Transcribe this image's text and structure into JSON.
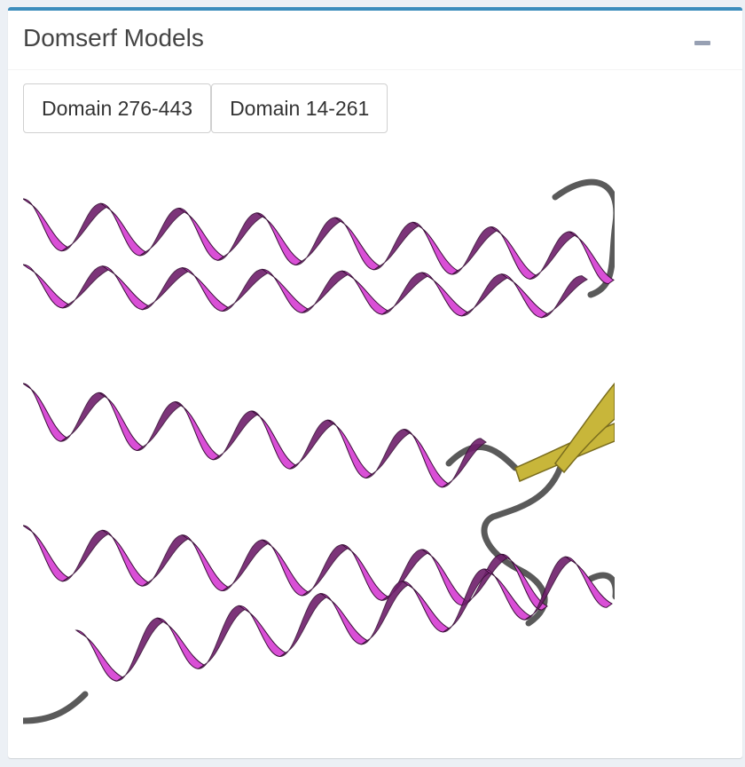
{
  "panel": {
    "title": "Domserf Models",
    "collapse_icon": "minus-icon"
  },
  "domain_buttons": [
    {
      "label": "Domain 276-443"
    },
    {
      "label": "Domain 14-261"
    }
  ],
  "viewer": {
    "colors": {
      "helix": "#d94fd6",
      "helix_dark": "#6e1f6b",
      "coil": "#5a5a5a",
      "strand": "#c8b63a",
      "accent": "#3c8dbc"
    }
  }
}
